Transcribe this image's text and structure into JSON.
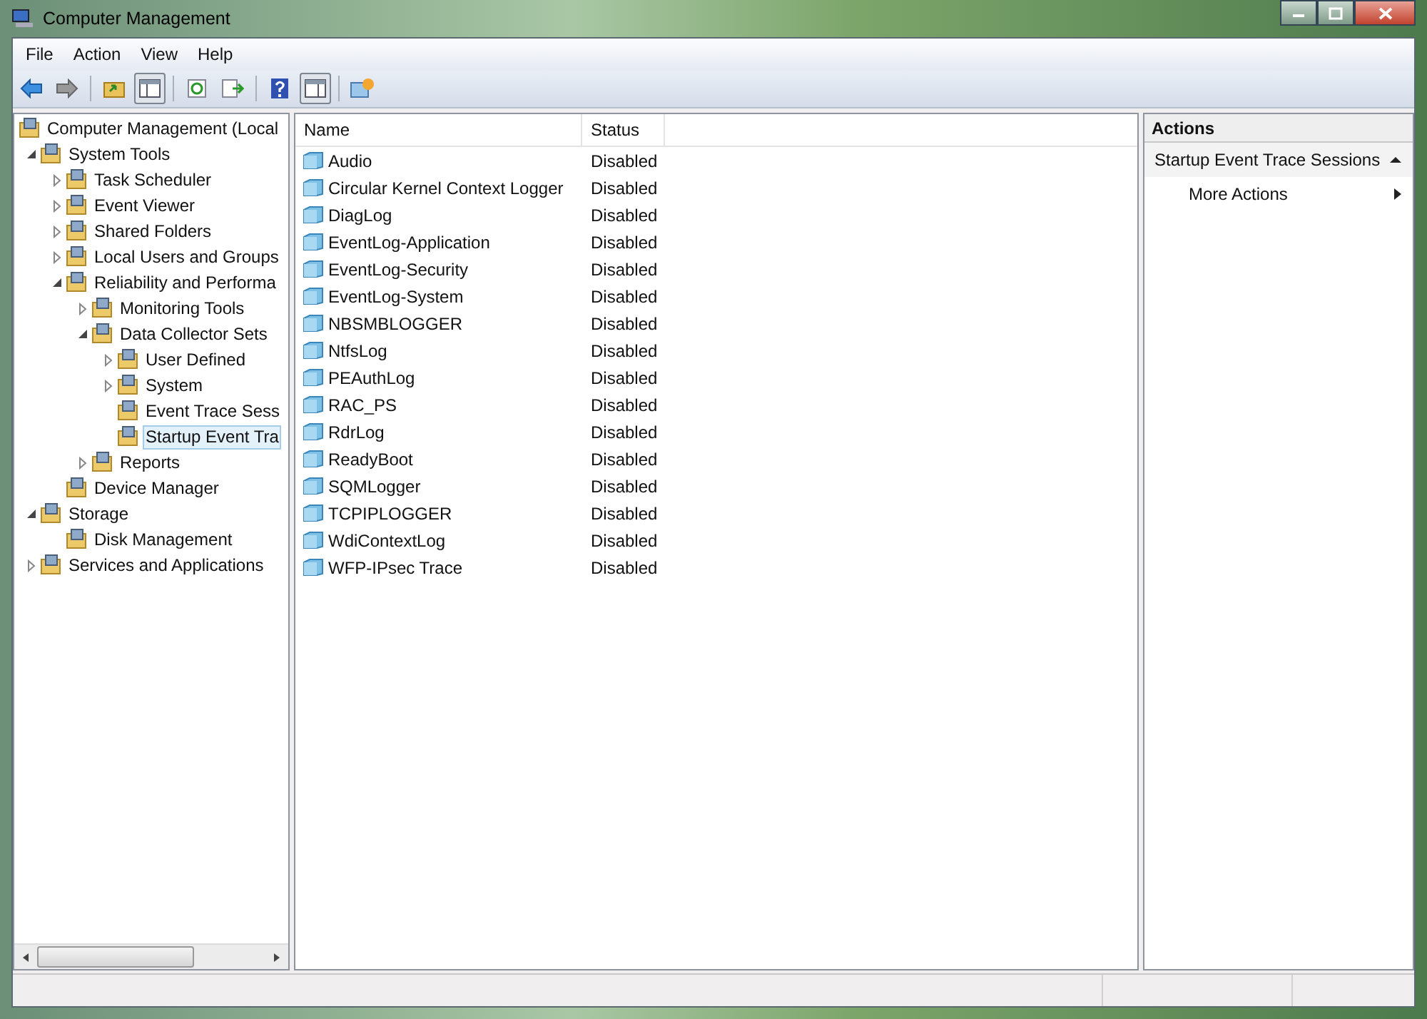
{
  "window": {
    "title": "Computer Management"
  },
  "menu": [
    "File",
    "Action",
    "View",
    "Help"
  ],
  "tree": [
    {
      "label": "Computer Management (Local",
      "selected": false,
      "children": [
        {
          "label": "System Tools",
          "expanded": true,
          "selected": false,
          "children": [
            {
              "label": "Task Scheduler",
              "expanded": false,
              "selected": false
            },
            {
              "label": "Event Viewer",
              "expanded": false,
              "selected": false
            },
            {
              "label": "Shared Folders",
              "expanded": false,
              "selected": false
            },
            {
              "label": "Local Users and Groups",
              "expanded": false,
              "selected": false
            },
            {
              "label": "Reliability and Performa",
              "expanded": true,
              "selected": false,
              "children": [
                {
                  "label": "Monitoring Tools",
                  "expanded": false,
                  "selected": false
                },
                {
                  "label": "Data Collector Sets",
                  "expanded": true,
                  "selected": false,
                  "children": [
                    {
                      "label": "User Defined",
                      "expanded": false,
                      "selected": false
                    },
                    {
                      "label": "System",
                      "expanded": false,
                      "selected": false
                    },
                    {
                      "label": "Event Trace Sess",
                      "selected": false
                    },
                    {
                      "label": "Startup Event Tra",
                      "selected": true
                    }
                  ]
                },
                {
                  "label": "Reports",
                  "expanded": false,
                  "selected": false
                }
              ]
            },
            {
              "label": "Device Manager",
              "selected": false
            }
          ]
        },
        {
          "label": "Storage",
          "expanded": true,
          "selected": false,
          "children": [
            {
              "label": "Disk Management",
              "selected": false
            }
          ]
        },
        {
          "label": "Services and Applications",
          "expanded": false,
          "selected": false
        }
      ]
    }
  ],
  "table": {
    "columns": [
      "Name",
      "Status"
    ],
    "rows": [
      {
        "name": "Audio",
        "status": "Disabled"
      },
      {
        "name": "Circular Kernel Context Logger",
        "status": "Disabled"
      },
      {
        "name": "DiagLog",
        "status": "Disabled"
      },
      {
        "name": "EventLog-Application",
        "status": "Disabled"
      },
      {
        "name": "EventLog-Security",
        "status": "Disabled"
      },
      {
        "name": "EventLog-System",
        "status": "Disabled"
      },
      {
        "name": "NBSMBLOGGER",
        "status": "Disabled"
      },
      {
        "name": "NtfsLog",
        "status": "Disabled"
      },
      {
        "name": "PEAuthLog",
        "status": "Disabled"
      },
      {
        "name": "RAC_PS",
        "status": "Disabled"
      },
      {
        "name": "RdrLog",
        "status": "Disabled"
      },
      {
        "name": "ReadyBoot",
        "status": "Disabled"
      },
      {
        "name": "SQMLogger",
        "status": "Disabled"
      },
      {
        "name": "TCPIPLOGGER",
        "status": "Disabled"
      },
      {
        "name": "WdiContextLog",
        "status": "Disabled"
      },
      {
        "name": "WFP-IPsec Trace",
        "status": "Disabled"
      }
    ]
  },
  "actions": {
    "title": "Actions",
    "section": {
      "label": "Startup Event Trace Sessions",
      "expanded": true
    },
    "items": [
      "More Actions"
    ]
  }
}
